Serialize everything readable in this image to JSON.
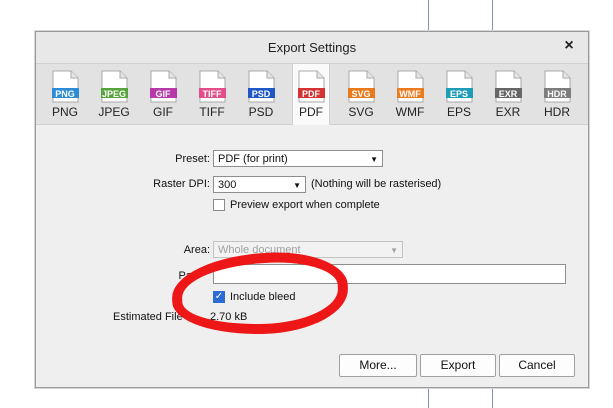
{
  "dialog": {
    "title": "Export Settings"
  },
  "formats": [
    {
      "label": "PNG",
      "badge": "PNG",
      "color": "#2d8cd6",
      "active": false
    },
    {
      "label": "JPEG",
      "badge": "JPEG",
      "color": "#56a43b",
      "active": false
    },
    {
      "label": "GIF",
      "badge": "GIF",
      "color": "#b73aa8",
      "active": false
    },
    {
      "label": "TIFF",
      "badge": "TIFF",
      "color": "#e24d8a",
      "active": false
    },
    {
      "label": "PSD",
      "badge": "PSD",
      "color": "#1f58c6",
      "active": false
    },
    {
      "label": "PDF",
      "badge": "PDF",
      "color": "#d43333",
      "active": true
    },
    {
      "label": "SVG",
      "badge": "SVG",
      "color": "#e97a1b",
      "active": false
    },
    {
      "label": "WMF",
      "badge": "WMF",
      "color": "#ea7b1e",
      "active": false
    },
    {
      "label": "EPS",
      "badge": "EPS",
      "color": "#1e9db8",
      "active": false
    },
    {
      "label": "EXR",
      "badge": "EXR",
      "color": "#666666",
      "active": false
    },
    {
      "label": "HDR",
      "badge": "HDR",
      "color": "#7d7d7d",
      "active": false
    }
  ],
  "settings": {
    "preset_label": "Preset:",
    "preset_value": "PDF (for print)",
    "raster_label": "Raster DPI:",
    "raster_value": "300",
    "raster_note": "(Nothing will be rasterised)",
    "preview_label": "Preview export when complete",
    "area_label": "Area:",
    "area_value": "Whole document",
    "pages_label": "Pa",
    "include_bleed_label": "Include bleed",
    "estimated_label": "Estimated File",
    "estimated_value": "2.70 kB"
  },
  "buttons": {
    "more": "More...",
    "export": "Export",
    "cancel": "Cancel"
  },
  "icons": {
    "close": "×",
    "check": "✓",
    "dropdown": "▼"
  }
}
